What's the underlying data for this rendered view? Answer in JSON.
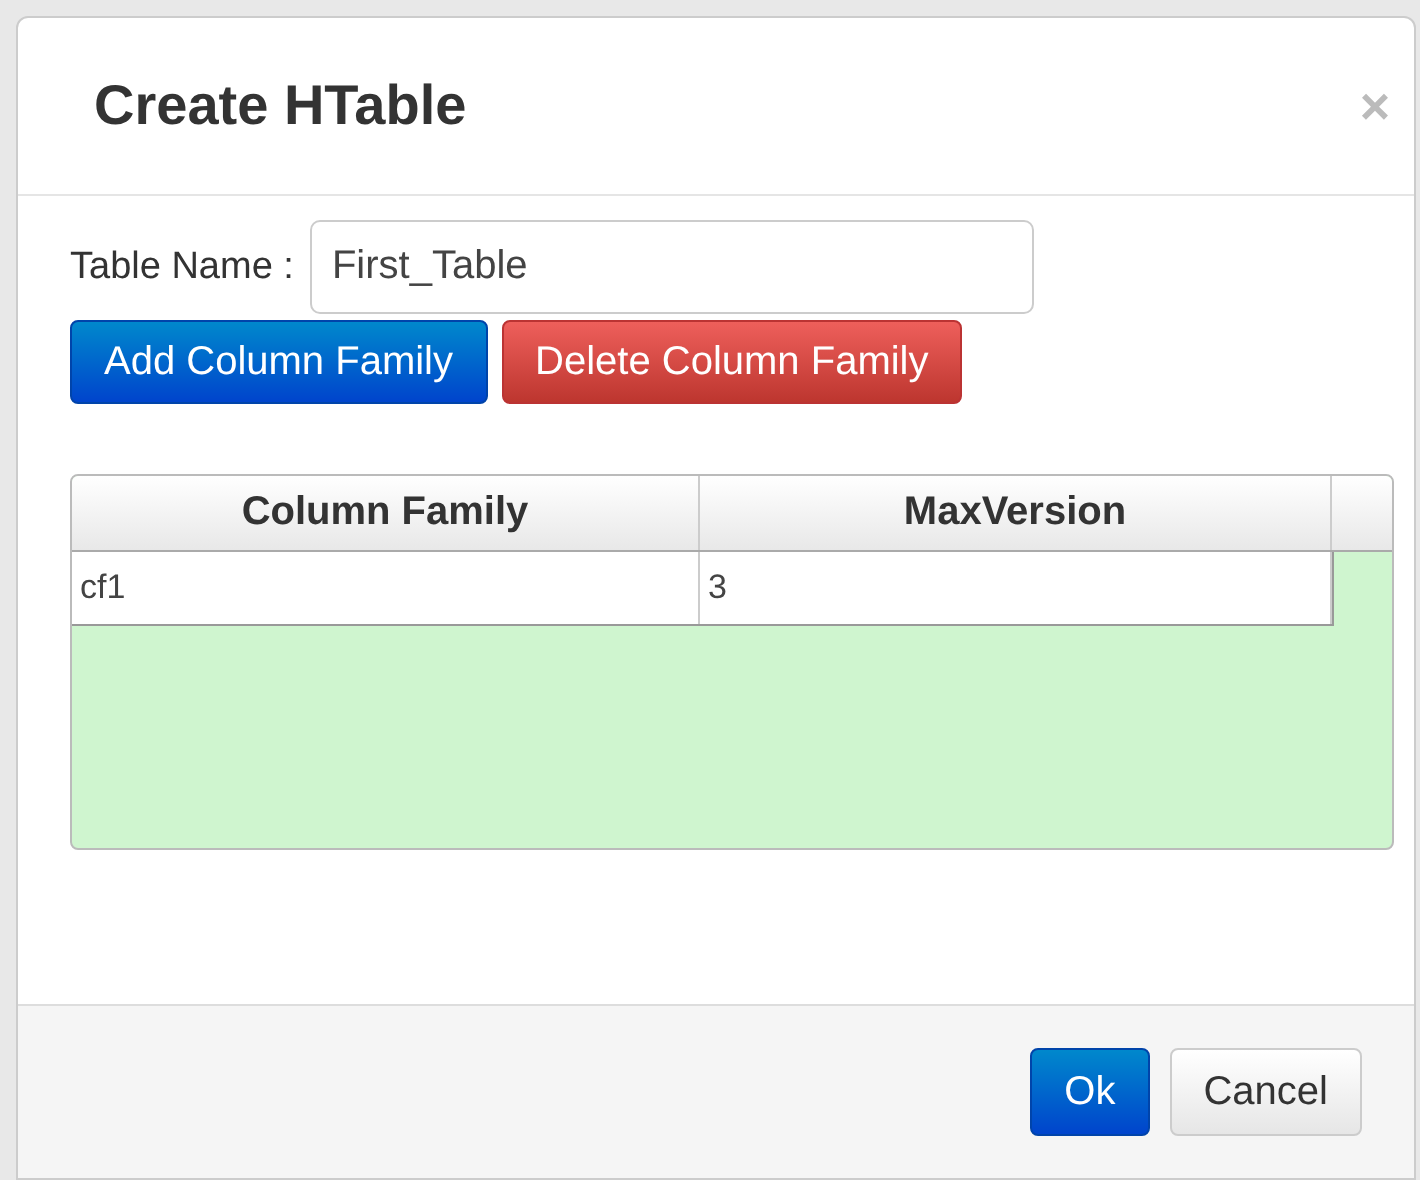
{
  "dialog": {
    "title": "Create HTable",
    "close": "×"
  },
  "form": {
    "label": "Table Name :",
    "value": "First_Table"
  },
  "actions": [
    {
      "label": "Add Column Family",
      "kind": "primary"
    },
    {
      "label": "Delete Column Family",
      "kind": "danger"
    }
  ],
  "table": {
    "columns": [
      "Column Family",
      "MaxVersion"
    ],
    "rows": [
      [
        "cf1",
        "3"
      ]
    ]
  },
  "footer_buttons": [
    {
      "label": "Ok",
      "kind": "primary"
    },
    {
      "label": "Cancel",
      "kind": "default"
    }
  ]
}
